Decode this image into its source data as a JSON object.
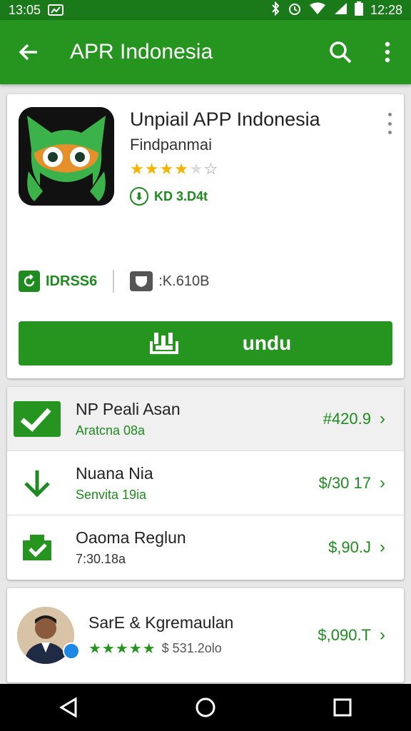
{
  "status_bar": {
    "time": "13:05",
    "clock_right": "12:28",
    "icons": [
      "notification-icon",
      "bluetooth-icon",
      "alarm-icon",
      "wifi-icon",
      "signal-icon",
      "battery-icon"
    ]
  },
  "app_bar": {
    "title": "APR Indonesia",
    "back_icon": "arrow-back-icon",
    "search_icon": "search-icon",
    "menu_icon": "more-vert-icon"
  },
  "app": {
    "name": "Unpiail APP Indonesia",
    "developer": "Findpanmai",
    "rating": 4,
    "badge_label": "KD 3.D4t",
    "downloads_label": "IDRSS6",
    "size_label": ":K.610B",
    "install_label": "undu"
  },
  "list": [
    {
      "title": "NP Peali Asan",
      "subtitle": "Aratcna 08a",
      "price": "#420.9",
      "icon": "check-box-icon"
    },
    {
      "title": "Nuana Nia",
      "subtitle": "Senvita 19ia",
      "price": "$/30 17",
      "icon": "download-arrow-icon"
    },
    {
      "title": "Oaoma Reglun",
      "subtitle": "7:30.18a",
      "price": "$,90.J",
      "icon": "folder-check-icon"
    }
  ],
  "review": {
    "name": "SarE & Kgremaulan",
    "rating": 5,
    "meta": "$ 531.2olo",
    "price": "$,090.T"
  },
  "colors": {
    "primary": "#25951f",
    "status_bar": "#1a7a1a",
    "accent_text": "#1f8a1f",
    "star": "#f5b400"
  }
}
